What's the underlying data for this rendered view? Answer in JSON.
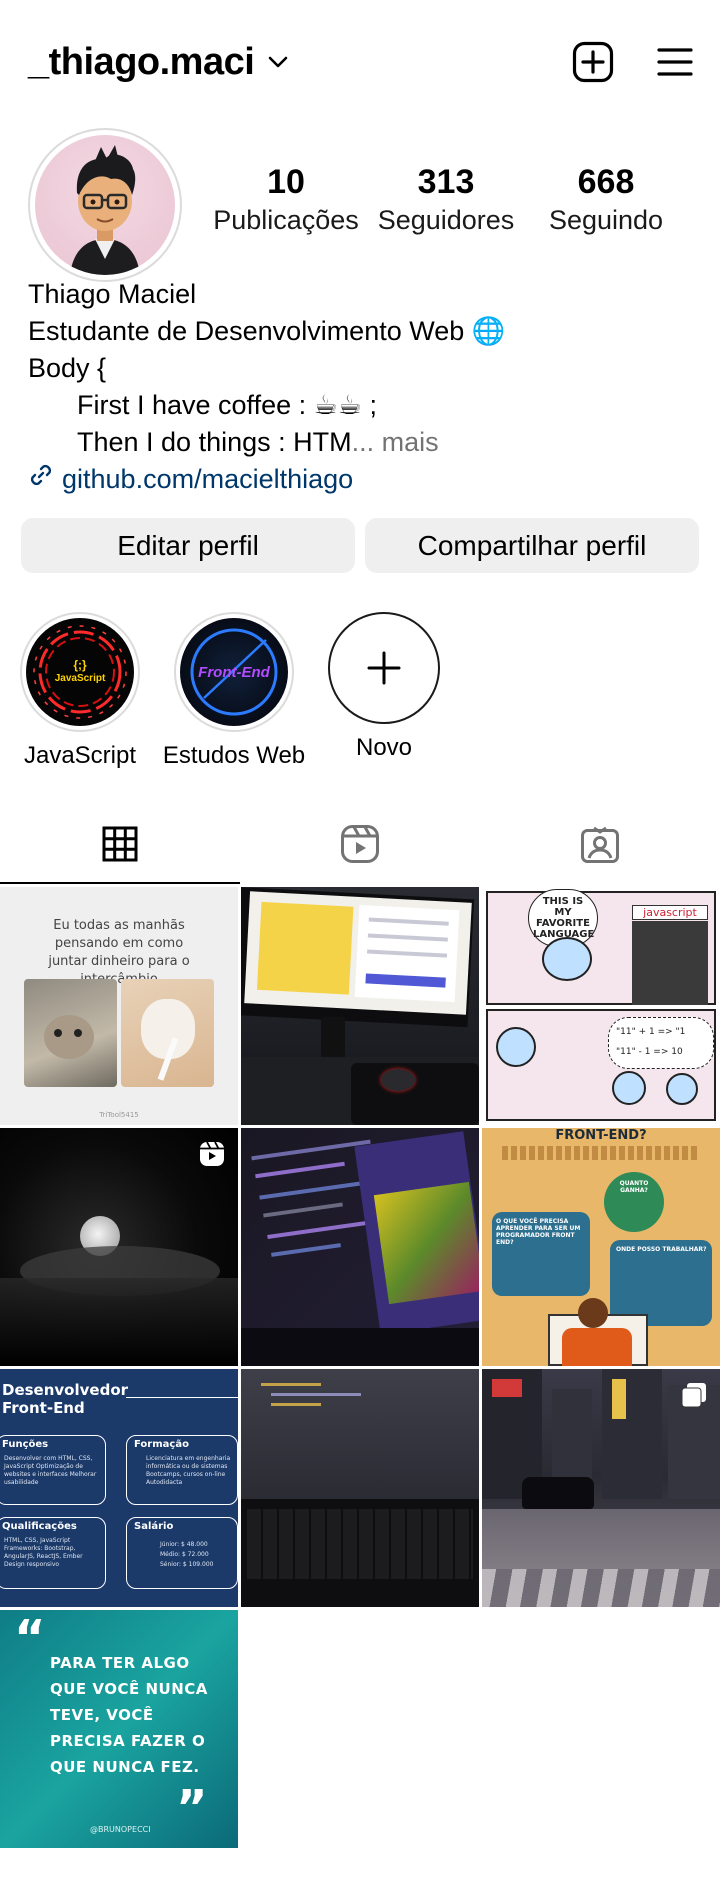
{
  "header": {
    "username": "_thiago.maci"
  },
  "stats": [
    {
      "count": "10",
      "label": "Publicações"
    },
    {
      "count": "313",
      "label": "Seguidores"
    },
    {
      "count": "668",
      "label": "Seguindo"
    }
  ],
  "bio": {
    "name": "Thiago Maciel",
    "line1": "Estudante de Desenvolvimento Web 🌐",
    "line2": "Body {",
    "line3": "First I have coffee : ☕☕ ;",
    "line4": "Then I do things : HTM",
    "line4_ellipsis": "...",
    "more": " mais",
    "link": "github.com/macielthiago"
  },
  "buttons": {
    "edit": "Editar perfil",
    "share": "Compartilhar perfil"
  },
  "highlights": [
    {
      "label": "JavaScript",
      "badge": "{;}",
      "badge_title": "JavaScript"
    },
    {
      "label": "Estudos Web",
      "badge_title": "Front-End"
    },
    {
      "label": "Novo"
    }
  ],
  "posts": {
    "p1_text": "Eu todas as manhãs pensando em como juntar dinheiro para o intercâmbio",
    "p1_credit": "TriTool54",
    "p1_credit2": "15",
    "p3_bubble1": "THIS IS MY FAVORITE LANGUAGE",
    "p3_sign": "javascript",
    "p3_expr1": "\"11\" + 1 => \"1",
    "p3_expr2": "\"11\" - 1 => 10",
    "p6_title": "FRONT-END?",
    "p6_bubble_q": "O QUE VOCÊ PRECISA APRENDER PARA SER UM PROGRAMADOR FRONT END?",
    "p6_bubble_money": "QUANTO GANHA?",
    "p6_bubble_work": "ONDE POSSO TRABALHAR?",
    "p7_title": "Desenvolvedor Front-End",
    "p7_h1": "Funções",
    "p7_h2": "Formação",
    "p7_h3": "Qualificações",
    "p7_h4": "Salário",
    "p7_f1": "Desenvolver com HTML, CSS, JavaScript Optimização de websites e interfaces Melhorar usabilidade",
    "p7_f2": "Licenciatura em engenharia informática ou de sistemas Bootcamps, cursos on-line Autodidacta",
    "p7_f3": "HTML, CSS, JavaScript Frameworks: Bootstrap, AngularJS, ReactJS, Ember Design responsivo",
    "p7_s1": "Júnior: $ 48.000",
    "p7_s2": "Médio: $ 72.000",
    "p7_s3": "Sénior: $ 109.000",
    "p10_quote": "PARA TER ALGO QUE VOCÊ NUNCA TEVE, VOCÊ PRECISA FAZER O QUE NUNCA FEZ.",
    "p10_handle": "@BRUNOPECCI"
  },
  "colors": {
    "link": "#00376b",
    "button_bg": "#efefef",
    "muted": "#737373"
  }
}
